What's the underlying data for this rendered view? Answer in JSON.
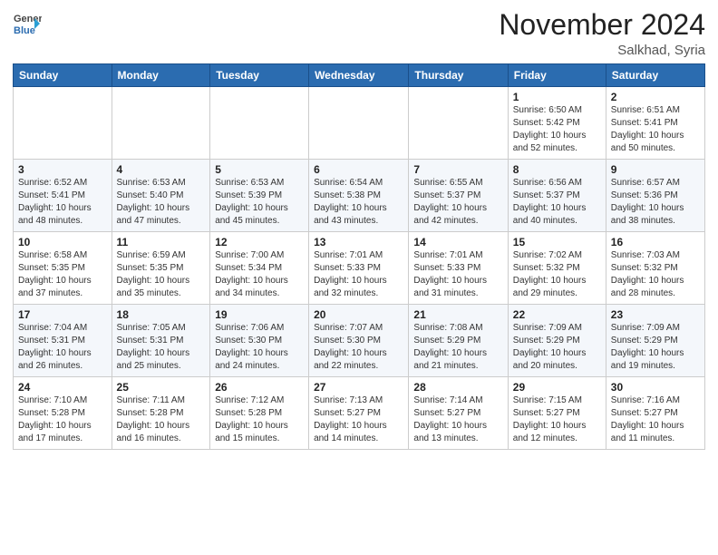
{
  "header": {
    "logo_general": "General",
    "logo_blue": "Blue",
    "month": "November 2024",
    "location": "Salkhad, Syria"
  },
  "weekdays": [
    "Sunday",
    "Monday",
    "Tuesday",
    "Wednesday",
    "Thursday",
    "Friday",
    "Saturday"
  ],
  "weeks": [
    [
      {
        "day": "",
        "info": ""
      },
      {
        "day": "",
        "info": ""
      },
      {
        "day": "",
        "info": ""
      },
      {
        "day": "",
        "info": ""
      },
      {
        "day": "",
        "info": ""
      },
      {
        "day": "1",
        "info": "Sunrise: 6:50 AM\nSunset: 5:42 PM\nDaylight: 10 hours\nand 52 minutes."
      },
      {
        "day": "2",
        "info": "Sunrise: 6:51 AM\nSunset: 5:41 PM\nDaylight: 10 hours\nand 50 minutes."
      }
    ],
    [
      {
        "day": "3",
        "info": "Sunrise: 6:52 AM\nSunset: 5:41 PM\nDaylight: 10 hours\nand 48 minutes."
      },
      {
        "day": "4",
        "info": "Sunrise: 6:53 AM\nSunset: 5:40 PM\nDaylight: 10 hours\nand 47 minutes."
      },
      {
        "day": "5",
        "info": "Sunrise: 6:53 AM\nSunset: 5:39 PM\nDaylight: 10 hours\nand 45 minutes."
      },
      {
        "day": "6",
        "info": "Sunrise: 6:54 AM\nSunset: 5:38 PM\nDaylight: 10 hours\nand 43 minutes."
      },
      {
        "day": "7",
        "info": "Sunrise: 6:55 AM\nSunset: 5:37 PM\nDaylight: 10 hours\nand 42 minutes."
      },
      {
        "day": "8",
        "info": "Sunrise: 6:56 AM\nSunset: 5:37 PM\nDaylight: 10 hours\nand 40 minutes."
      },
      {
        "day": "9",
        "info": "Sunrise: 6:57 AM\nSunset: 5:36 PM\nDaylight: 10 hours\nand 38 minutes."
      }
    ],
    [
      {
        "day": "10",
        "info": "Sunrise: 6:58 AM\nSunset: 5:35 PM\nDaylight: 10 hours\nand 37 minutes."
      },
      {
        "day": "11",
        "info": "Sunrise: 6:59 AM\nSunset: 5:35 PM\nDaylight: 10 hours\nand 35 minutes."
      },
      {
        "day": "12",
        "info": "Sunrise: 7:00 AM\nSunset: 5:34 PM\nDaylight: 10 hours\nand 34 minutes."
      },
      {
        "day": "13",
        "info": "Sunrise: 7:01 AM\nSunset: 5:33 PM\nDaylight: 10 hours\nand 32 minutes."
      },
      {
        "day": "14",
        "info": "Sunrise: 7:01 AM\nSunset: 5:33 PM\nDaylight: 10 hours\nand 31 minutes."
      },
      {
        "day": "15",
        "info": "Sunrise: 7:02 AM\nSunset: 5:32 PM\nDaylight: 10 hours\nand 29 minutes."
      },
      {
        "day": "16",
        "info": "Sunrise: 7:03 AM\nSunset: 5:32 PM\nDaylight: 10 hours\nand 28 minutes."
      }
    ],
    [
      {
        "day": "17",
        "info": "Sunrise: 7:04 AM\nSunset: 5:31 PM\nDaylight: 10 hours\nand 26 minutes."
      },
      {
        "day": "18",
        "info": "Sunrise: 7:05 AM\nSunset: 5:31 PM\nDaylight: 10 hours\nand 25 minutes."
      },
      {
        "day": "19",
        "info": "Sunrise: 7:06 AM\nSunset: 5:30 PM\nDaylight: 10 hours\nand 24 minutes."
      },
      {
        "day": "20",
        "info": "Sunrise: 7:07 AM\nSunset: 5:30 PM\nDaylight: 10 hours\nand 22 minutes."
      },
      {
        "day": "21",
        "info": "Sunrise: 7:08 AM\nSunset: 5:29 PM\nDaylight: 10 hours\nand 21 minutes."
      },
      {
        "day": "22",
        "info": "Sunrise: 7:09 AM\nSunset: 5:29 PM\nDaylight: 10 hours\nand 20 minutes."
      },
      {
        "day": "23",
        "info": "Sunrise: 7:09 AM\nSunset: 5:29 PM\nDaylight: 10 hours\nand 19 minutes."
      }
    ],
    [
      {
        "day": "24",
        "info": "Sunrise: 7:10 AM\nSunset: 5:28 PM\nDaylight: 10 hours\nand 17 minutes."
      },
      {
        "day": "25",
        "info": "Sunrise: 7:11 AM\nSunset: 5:28 PM\nDaylight: 10 hours\nand 16 minutes."
      },
      {
        "day": "26",
        "info": "Sunrise: 7:12 AM\nSunset: 5:28 PM\nDaylight: 10 hours\nand 15 minutes."
      },
      {
        "day": "27",
        "info": "Sunrise: 7:13 AM\nSunset: 5:27 PM\nDaylight: 10 hours\nand 14 minutes."
      },
      {
        "day": "28",
        "info": "Sunrise: 7:14 AM\nSunset: 5:27 PM\nDaylight: 10 hours\nand 13 minutes."
      },
      {
        "day": "29",
        "info": "Sunrise: 7:15 AM\nSunset: 5:27 PM\nDaylight: 10 hours\nand 12 minutes."
      },
      {
        "day": "30",
        "info": "Sunrise: 7:16 AM\nSunset: 5:27 PM\nDaylight: 10 hours\nand 11 minutes."
      }
    ]
  ]
}
